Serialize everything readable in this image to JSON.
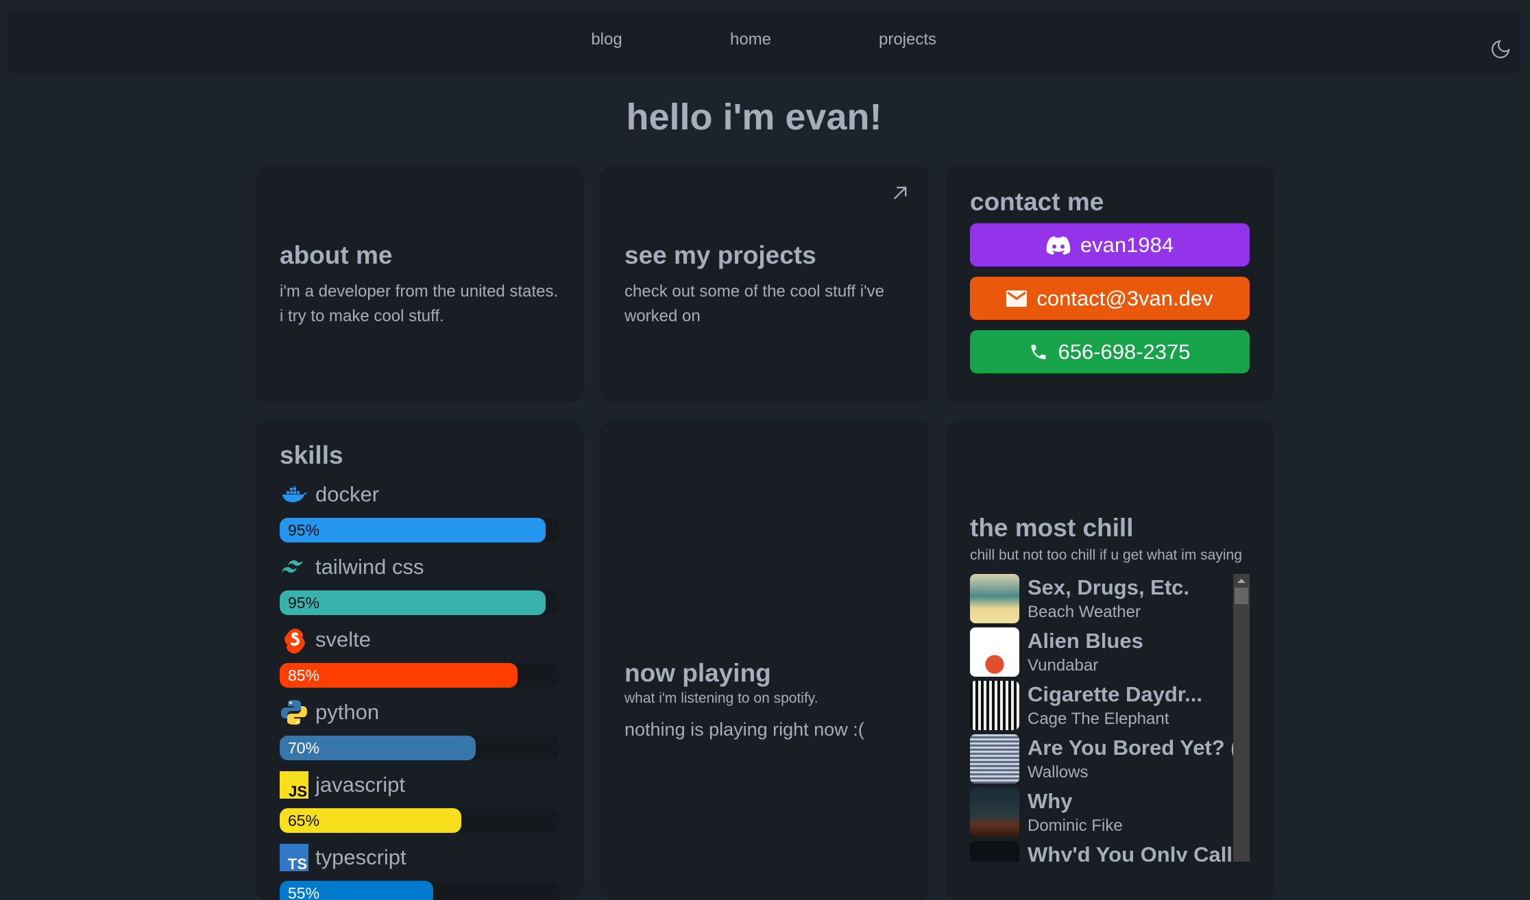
{
  "nav": {
    "items": [
      {
        "label": "blog"
      },
      {
        "label": "home"
      },
      {
        "label": "projects"
      }
    ],
    "theme_icon": "moon-icon"
  },
  "title": "hello i'm evan!",
  "about": {
    "title": "about me",
    "text": "i'm a developer from the united states. i try to make cool stuff."
  },
  "projects": {
    "title": "see my projects",
    "text": "check out some of the cool stuff i've worked on",
    "icon": "arrow-up-right-icon"
  },
  "contact": {
    "title": "contact me",
    "buttons": [
      {
        "label": "evan1984",
        "icon": "discord-icon",
        "color": "#9333ea"
      },
      {
        "label": "contact@3van.dev",
        "icon": "mail-icon",
        "color": "#ea580c"
      },
      {
        "label": "656-698-2375",
        "icon": "phone-icon",
        "color": "#16a34a"
      }
    ]
  },
  "skills": {
    "title": "skills",
    "items": [
      {
        "name": "docker",
        "percent": 95,
        "label": "95%",
        "color": "#2496ed",
        "text": "#111",
        "icon": "docker-icon"
      },
      {
        "name": "tailwind css",
        "percent": 95,
        "label": "95%",
        "color": "#38b2ac",
        "text": "#111",
        "icon": "tailwind-icon"
      },
      {
        "name": "svelte",
        "percent": 85,
        "label": "85%",
        "color": "#ff3e00",
        "text": "#fff",
        "icon": "svelte-icon"
      },
      {
        "name": "python",
        "percent": 70,
        "label": "70%",
        "color": "#3776ab",
        "text": "#fff",
        "icon": "python-icon"
      },
      {
        "name": "javascript",
        "percent": 65,
        "label": "65%",
        "color": "#f7df1e",
        "text": "#111",
        "icon": "javascript-icon"
      },
      {
        "name": "typescript",
        "percent": 55,
        "label": "55%",
        "color": "#007acc",
        "text": "#fff",
        "icon": "typescript-icon"
      }
    ]
  },
  "now_playing": {
    "title": "now playing",
    "subtitle": "what i'm listening to on spotify.",
    "status": "nothing is playing right now :("
  },
  "playlist": {
    "title": "the most chill",
    "description": "chill but not too chill if u get what im saying",
    "songs": [
      {
        "title": "Sex, Drugs, Etc.",
        "artist": "Beach Weather"
      },
      {
        "title": "Alien Blues",
        "artist": "Vundabar"
      },
      {
        "title": "Cigarette Daydr...",
        "artist": "Cage The Elephant"
      },
      {
        "title": "Are You Bored Yet? (...",
        "artist": "Wallows"
      },
      {
        "title": "Why",
        "artist": "Dominic Fike"
      },
      {
        "title": "Why'd You Only Call Me...",
        "artist": ""
      }
    ]
  }
}
